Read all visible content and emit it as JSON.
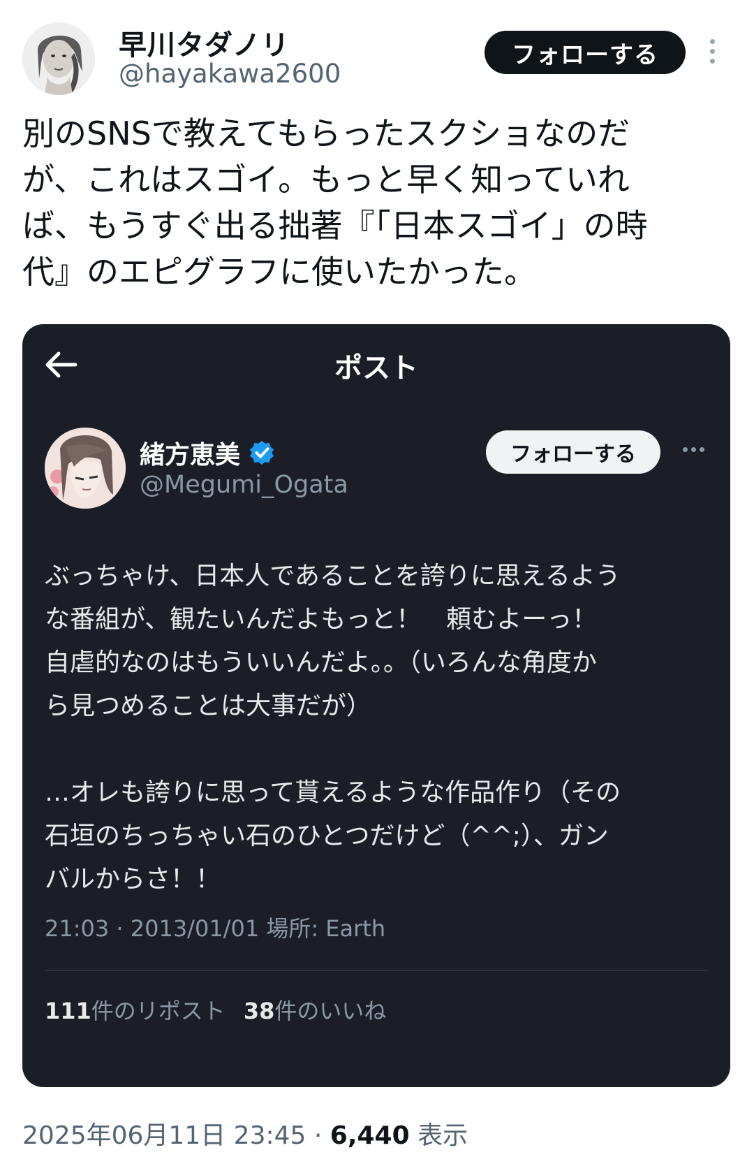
{
  "author": {
    "display_name": "早川タダノリ",
    "handle": "@hayakawa2600",
    "follow_label": "フォローする"
  },
  "tweet": {
    "lines": [
      "別のSNSで教えてもらったスクショなのだ",
      "が、これはスゴイ。もっと早く知っていれ",
      "ば、もうすぐ出る拙著『「日本スゴイ」の時",
      "代』のエピグラフに使いたかった。"
    ]
  },
  "embedded": {
    "header_title": "ポスト",
    "author_name": "緒方恵美",
    "author_handle": "@Megumi_Ogata",
    "follow_label": "フォローする",
    "paragraph1": [
      "ぶっちゃけ、日本人であることを誇りに思えるよう",
      "な番組が、観たいんだよもっと！　頼むよーっ！",
      "自虐的なのはもういいんだよ。。（いろんな角度か",
      "ら見つめることは大事だが）"
    ],
    "paragraph2": [
      "…オレも誇りに思って貰えるような作品作り（その",
      "石垣のちっちゃい石のひとつだけど（^^;）、ガン",
      "バルからさ！！"
    ],
    "meta": "21:03 · 2013/01/01 場所: Earth",
    "reposts_count": "111",
    "reposts_label": "件のリポスト",
    "likes_count": "38",
    "likes_label": "件のいいね"
  },
  "footer": {
    "timestamp": "2025年06月11日 23:45 · ",
    "views_count": "6,440",
    "views_label": " 表示"
  },
  "icons": {
    "more": "more-vertical-icon",
    "back": "arrow-left-icon",
    "verified": "verified-badge-icon",
    "inner_more": "more-horizontal-icon"
  },
  "colors": {
    "card_bg": "#1b1e27",
    "verified_blue": "#1d9bf0",
    "follow_bg": "#0f1419"
  }
}
